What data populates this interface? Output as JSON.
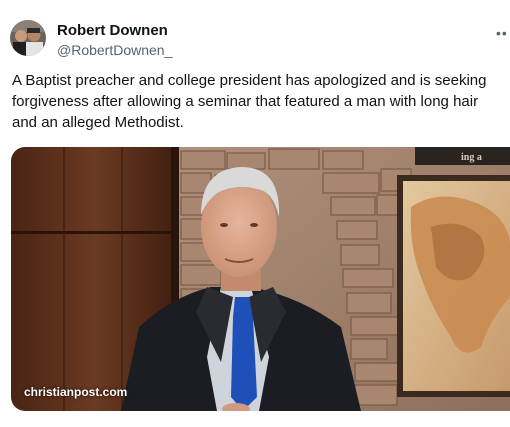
{
  "author": {
    "display_name": "Robert Downen",
    "handle": "@RobertDownen_"
  },
  "tweet": {
    "text_lines": [
      "A Baptist preacher and college president has apologized and is seeking",
      "forgiveness after allowing a seminar that featured a man with long hair",
      "and an alleged Methodist."
    ]
  },
  "media": {
    "watermark": "christianpost.com",
    "sign_text": "ing a"
  },
  "icons": {
    "more": "more-options-icon",
    "avatar": "avatar"
  }
}
